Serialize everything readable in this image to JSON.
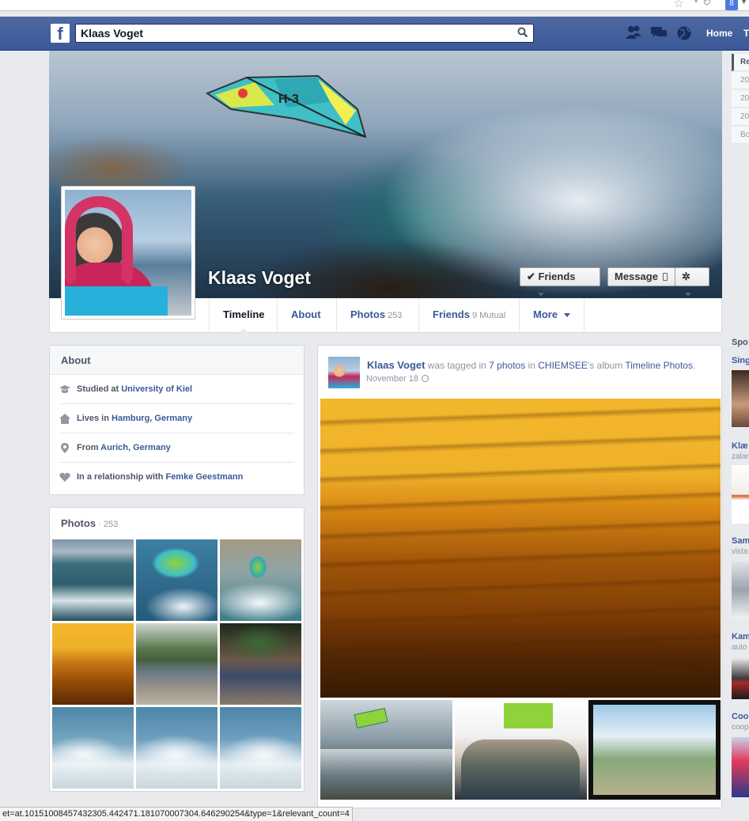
{
  "browser": {
    "google_button": "8"
  },
  "topbar": {
    "search_value": "Klaas Voget",
    "home_label": "Home",
    "truncated_label": "T"
  },
  "profile": {
    "name": "Klaas Voget",
    "friends_button": "Friends",
    "message_button": "Message"
  },
  "tabs": [
    {
      "label": "Timeline",
      "count": ""
    },
    {
      "label": "About",
      "count": ""
    },
    {
      "label": "Photos",
      "count": "253"
    },
    {
      "label": "Friends",
      "count": "9 Mutual"
    },
    {
      "label": "More",
      "count": ""
    }
  ],
  "about": {
    "title": "About",
    "rows": [
      {
        "prefix": "Studied at ",
        "link": "University of Kiel",
        "icon": "graduation-cap-icon"
      },
      {
        "prefix": "Lives in ",
        "link": "Hamburg, Germany",
        "icon": "house-icon"
      },
      {
        "prefix": "From ",
        "link": "Aurich, Germany",
        "icon": "map-pin-icon"
      },
      {
        "prefix": "In a relationship with ",
        "link": "Femke Geestmann",
        "icon": "heart-icon"
      }
    ]
  },
  "photos": {
    "title": "Photos",
    "separator": " · ",
    "count": "253"
  },
  "story": {
    "author": "Klaas Voget",
    "text1": " was tagged in ",
    "link1": "7 photos",
    "text2": " in ",
    "link2": "CHIEMSEE",
    "text3": "'s album ",
    "link3": "Timeline Photos",
    "text4": ".",
    "date": "November 18"
  },
  "right_rail": {
    "nav": [
      "Re",
      "20",
      "20",
      "20",
      "Bo"
    ],
    "sponsored_head": "Spo",
    "ads": [
      {
        "title": "Sing",
        "sub": ""
      },
      {
        "title": "Klæ",
        "sub": "zalar"
      },
      {
        "title": "Sam",
        "sub": "vista"
      },
      {
        "title": "Kam",
        "sub": "auto"
      },
      {
        "title": "Coo",
        "sub": "coop"
      }
    ]
  },
  "status_url": "et=at.10151008457432305.442471.181070007304.646290254&type=1&relevant_count=4",
  "colors": {
    "brand_blue": "#3b5998",
    "page_bg": "#e9eaed"
  }
}
